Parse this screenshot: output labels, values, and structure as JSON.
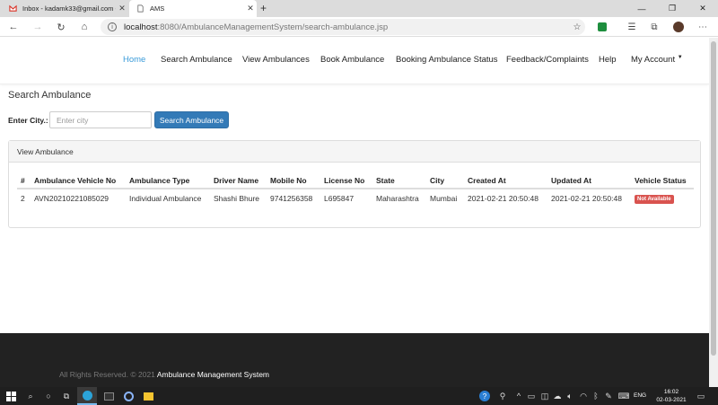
{
  "browser": {
    "tabs": [
      {
        "title": "Inbox - kadamk33@gmail.com -",
        "active": false
      },
      {
        "title": "AMS",
        "active": true
      }
    ],
    "url_host": "localhost",
    "url_path": ":8080/AmbulanceManagementSystem/search-ambulance.jsp"
  },
  "nav": {
    "items": [
      "Home",
      "Search Ambulance",
      "View Ambulances",
      "Book Ambulance",
      "Booking Ambulance Status",
      "Feedback/Complaints",
      "Help",
      "My Account"
    ],
    "active": "Home"
  },
  "search": {
    "title": "Search Ambulance",
    "city_label": "Enter City.:",
    "city_placeholder": "Enter city",
    "button_label": "Search Ambulance"
  },
  "panel": {
    "heading": "View Ambulance",
    "columns": [
      "#",
      "Ambulance Vehicle No",
      "Ambulance Type",
      "Driver Name",
      "Mobile No",
      "License No",
      "State",
      "City",
      "Created At",
      "Updated At",
      "Vehicle Status"
    ],
    "rows": [
      {
        "num": "2",
        "vehicle_no": "AVN20210221085029",
        "type": "Individual Ambulance",
        "driver": "Shashi Bhure",
        "mobile": "9741256358",
        "license": "L695847",
        "state": "Maharashtra",
        "city": "Mumbai",
        "created": "2021-02-21 20:50:48",
        "updated": "2021-02-21 20:50:48",
        "status": "Not Available"
      }
    ]
  },
  "footer": {
    "copyright": "All Rights Reserved. © 2021",
    "name": "Ambulance Management System"
  },
  "taskbar": {
    "language": "ENG",
    "time": "16:02",
    "date": "02-03-2021"
  },
  "colors": {
    "accent": "#3a9bd9",
    "primary_button": "#337ab7",
    "danger_badge": "#d9534f",
    "footer_bg": "#222222"
  }
}
